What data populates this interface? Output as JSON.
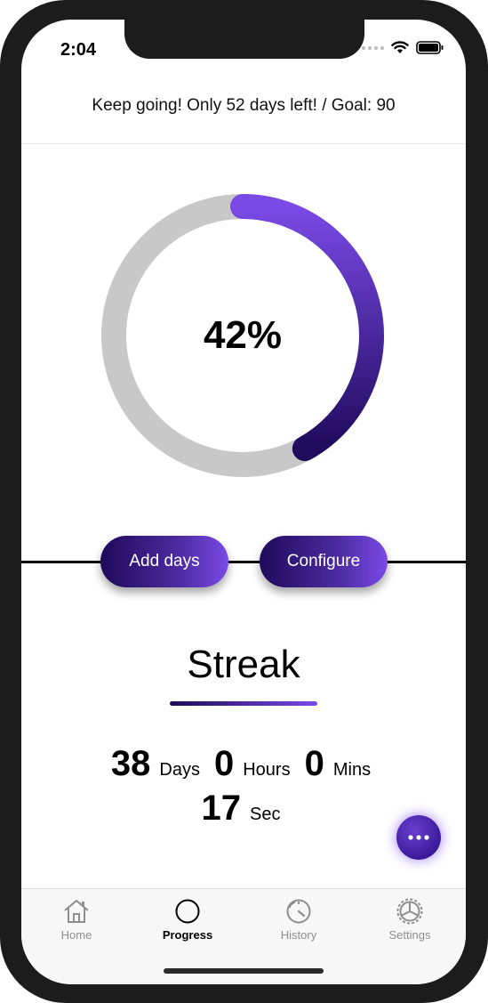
{
  "status_bar": {
    "time": "2:04"
  },
  "header": {
    "goal_message": "Keep going! Only 52 days left! / Goal: 90"
  },
  "progress": {
    "percent_label": "42%",
    "fraction": 0.42,
    "track_color": "#c8c8c8",
    "gradient_start": "#7a4ae6",
    "gradient_end": "#1f0a5c"
  },
  "actions": {
    "add_days_label": "Add days",
    "configure_label": "Configure"
  },
  "streak": {
    "title": "Streak",
    "days_value": "38",
    "days_unit": "Days",
    "hours_value": "0",
    "hours_unit": "Hours",
    "mins_value": "0",
    "mins_unit": "Mins",
    "secs_value": "17",
    "secs_unit": "Sec"
  },
  "fab": {
    "icon": "more-icon"
  },
  "tabbar": {
    "home_label": "Home",
    "progress_label": "Progress",
    "history_label": "History",
    "settings_label": "Settings",
    "active": "Progress"
  }
}
